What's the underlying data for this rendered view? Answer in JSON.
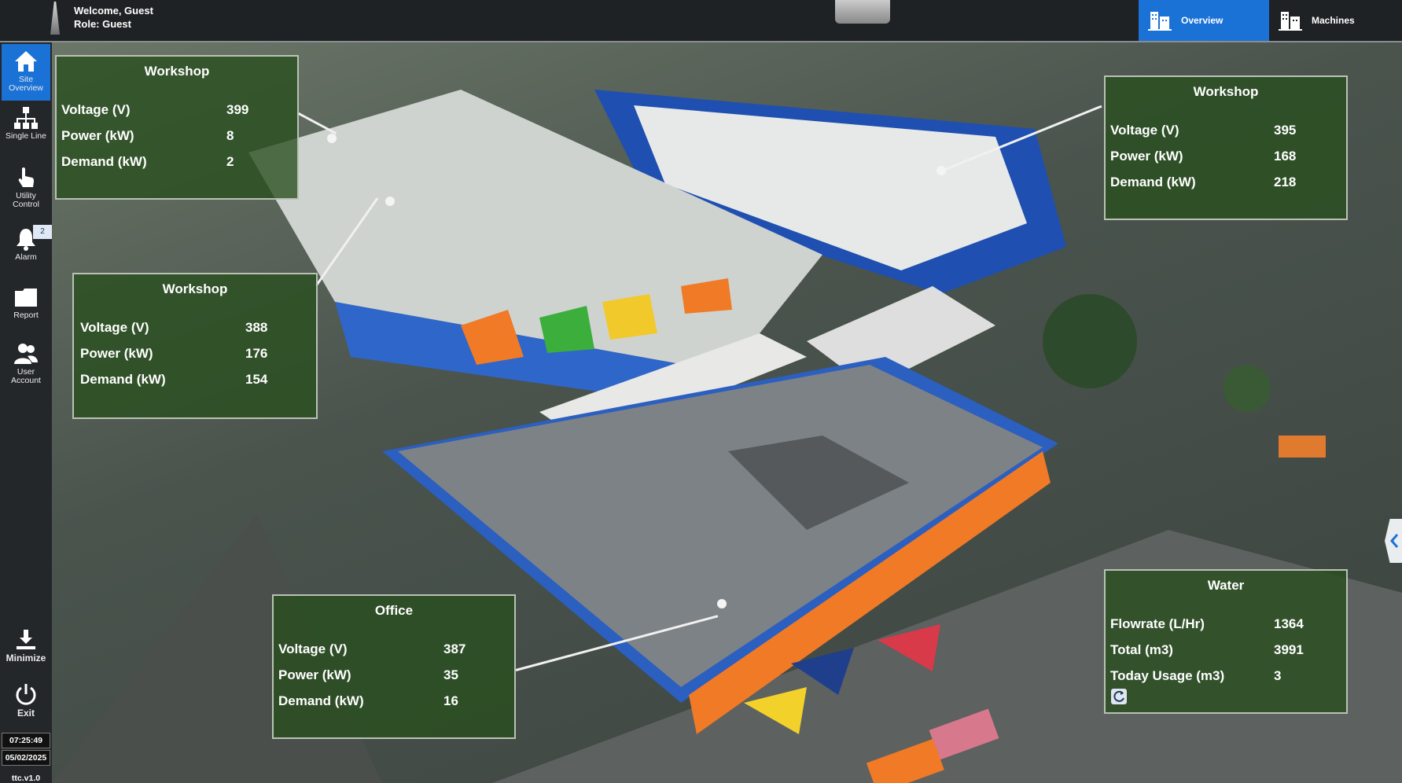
{
  "header": {
    "welcome": "Welcome, Guest",
    "role": "Role: Guest",
    "tabs": [
      {
        "label": "Overview",
        "icon": "building-icon",
        "active": true
      },
      {
        "label": "Machines",
        "icon": "building-icon",
        "active": false
      }
    ]
  },
  "sidebar": {
    "items": [
      {
        "label": "Site Overview",
        "icon": "home-icon",
        "active": true
      },
      {
        "label": "Single Line",
        "icon": "network-icon"
      },
      {
        "label": "Utility Control",
        "icon": "hand-pointer-icon"
      },
      {
        "label": "Alarm",
        "icon": "bell-icon",
        "badge": "2"
      },
      {
        "label": "Report",
        "icon": "folder-icon"
      },
      {
        "label": "User Account",
        "icon": "users-icon"
      },
      {
        "label": "Minimize",
        "icon": "download-icon"
      },
      {
        "label": "Exit",
        "icon": "power-icon"
      }
    ],
    "time": "07:25:49",
    "date": "05/02/2025",
    "version": "ttc.v1.0"
  },
  "panels": {
    "workshop_a": {
      "title": "Workshop",
      "rows": [
        {
          "label": "Voltage (V)",
          "value": "399"
        },
        {
          "label": "Power (kW)",
          "value": "8"
        },
        {
          "label": "Demand (kW)",
          "value": "2"
        }
      ]
    },
    "workshop_b": {
      "title": "Workshop",
      "rows": [
        {
          "label": "Voltage (V)",
          "value": "388"
        },
        {
          "label": "Power (kW)",
          "value": "176"
        },
        {
          "label": "Demand (kW)",
          "value": "154"
        }
      ]
    },
    "workshop_c": {
      "title": "Workshop",
      "rows": [
        {
          "label": "Voltage (V)",
          "value": "395"
        },
        {
          "label": "Power (kW)",
          "value": "168"
        },
        {
          "label": "Demand (kW)",
          "value": "218"
        }
      ]
    },
    "office": {
      "title": "Office",
      "rows": [
        {
          "label": "Voltage (V)",
          "value": "387"
        },
        {
          "label": "Power (kW)",
          "value": "35"
        },
        {
          "label": "Demand (kW)",
          "value": "16"
        }
      ]
    },
    "water": {
      "title": "Water",
      "rows": [
        {
          "label": "Flowrate (L/Hr)",
          "value": "1364"
        },
        {
          "label": "Total (m3)",
          "value": "3991"
        },
        {
          "label": "Today Usage (m3)",
          "value": "3"
        }
      ]
    }
  },
  "colors": {
    "accent": "#1b72d6",
    "panel": "#284e1e",
    "sidebar": "#24272a"
  }
}
